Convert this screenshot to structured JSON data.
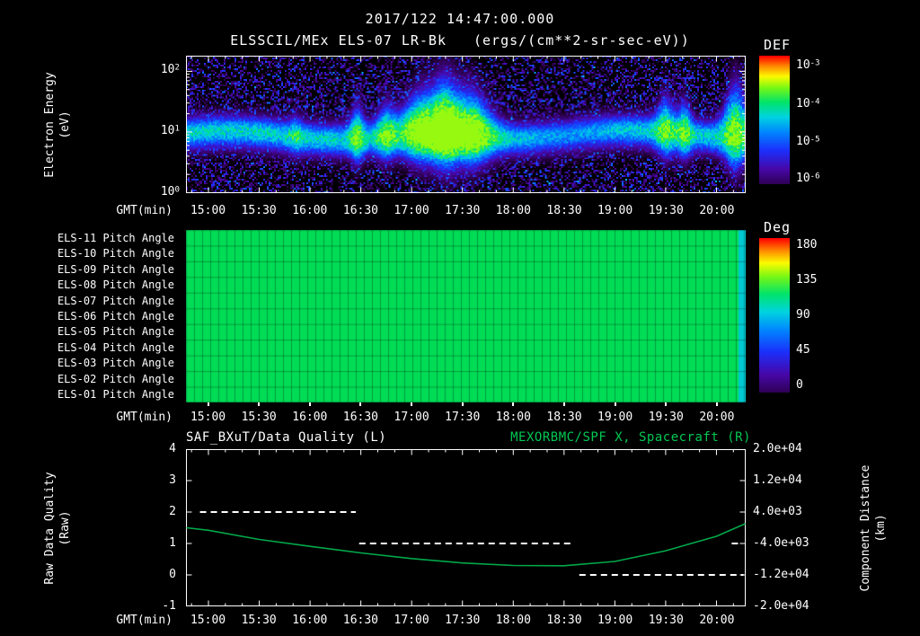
{
  "header": {
    "timestamp": "2017/122 14:47:00.000",
    "instrument_title": "ELSSCIL/MEx ELS-07 LR-Bk",
    "units_label": "(ergs/(cm**2-sr-sec-eV))"
  },
  "time_axis": {
    "label": "GMT(min)",
    "start": "14:47",
    "end": "20:17",
    "ticks": [
      "15:00",
      "15:30",
      "16:00",
      "16:30",
      "17:00",
      "17:30",
      "18:00",
      "18:30",
      "19:00",
      "19:30",
      "20:00"
    ]
  },
  "spectrogram": {
    "ylabel_line1": "Electron Energy",
    "ylabel_line2": "(eV)",
    "y_ticks": [
      {
        "label": "10^2",
        "log": 2
      },
      {
        "label": "10^1",
        "log": 1
      },
      {
        "label": "10^0",
        "log": 0
      }
    ],
    "colorbar": {
      "label": "DEF",
      "ticks": [
        "10^-3",
        "10^-4",
        "10^-5",
        "10^-6"
      ]
    }
  },
  "pitch_panel": {
    "colorbar": {
      "label": "Deg",
      "ticks": [
        "180",
        "135",
        "90",
        "45",
        "0"
      ]
    }
  },
  "bottom_panel": {
    "title_left": "SAF_BXuT/Data Quality (L)",
    "title_right": "MEXORBMC/SPF X, Spacecraft (R)",
    "ylabel_left_line1": "Raw Data Quality",
    "ylabel_left_line2": "(Raw)",
    "ylabel_right_line1": "Component Distance",
    "ylabel_right_line2": "(km)",
    "left_ticks": [
      "4",
      "3",
      "2",
      "1",
      "0",
      "-1"
    ],
    "right_ticks": [
      "2.0e+04",
      "1.2e+04",
      "4.0e+03",
      "-4.0e+03",
      "-1.2e+04",
      "-2.0e+04"
    ]
  },
  "colors": {
    "background": "#000000",
    "text": "#ffffff",
    "accent_green": "#00c853",
    "pitch_fill_green": "#00dc55",
    "pitch_edge_cyan": "#00c9cf"
  },
  "chart_data": [
    {
      "id": "electron-energy-spectrogram",
      "type": "heatmap",
      "title": "ELSSCIL/MEx ELS-07 LR-Bk",
      "units": "ergs/(cm**2-sr-sec-eV)",
      "x_range": [
        "14:47",
        "20:17"
      ],
      "x_ticks": [
        "15:00",
        "15:30",
        "16:00",
        "16:30",
        "17:00",
        "17:30",
        "18:00",
        "18:30",
        "19:00",
        "19:30",
        "20:00"
      ],
      "y_axis": {
        "label": "Electron Energy (eV)",
        "scale": "log",
        "range_eV": [
          1,
          178
        ]
      },
      "z_axis": {
        "label": "DEF",
        "scale": "log",
        "range": [
          1e-06,
          0.001
        ]
      },
      "background": "sparse blue-purple noise speckle over black",
      "band": {
        "center_eV": 9,
        "sigma_decades": 0.18,
        "base_level": 0.6
      },
      "enhancements": [
        {
          "time": "15:52",
          "width_min": 3,
          "amp": 0.1,
          "height": 0.08
        },
        {
          "time": "16:28",
          "width_min": 3,
          "amp": 0.22,
          "height": 0.3
        },
        {
          "time": "16:45",
          "width_min": 4,
          "amp": 0.2,
          "height": 0.25
        },
        {
          "time": "17:05",
          "width_min": 8,
          "amp": 0.26,
          "height": 0.4
        },
        {
          "time": "17:20",
          "width_min": 6,
          "amp": 0.28,
          "height": 0.45
        },
        {
          "time": "17:36",
          "width_min": 8,
          "amp": 0.26,
          "height": 0.4
        },
        {
          "time": "17:25",
          "width_min": 20,
          "amp": 0.12,
          "height": 0.15
        },
        {
          "time": "18:30",
          "width_min": 25,
          "amp": -0.1,
          "height": -0.05
        },
        {
          "time": "19:30",
          "width_min": 4,
          "amp": 0.22,
          "height": 0.35
        },
        {
          "time": "19:41",
          "width_min": 3,
          "amp": 0.2,
          "height": 0.3
        },
        {
          "time": "20:11",
          "width_min": 5,
          "amp": 0.24,
          "height": 0.7
        }
      ]
    },
    {
      "id": "pitch-angle-panel",
      "type": "heatmap",
      "rows": [
        "ELS-11 Pitch Angle",
        "ELS-10 Pitch Angle",
        "ELS-09 Pitch Angle",
        "ELS-08 Pitch Angle",
        "ELS-07 Pitch Angle",
        "ELS-06 Pitch Angle",
        "ELS-05 Pitch Angle",
        "ELS-04 Pitch Angle",
        "ELS-03 Pitch Angle",
        "ELS-02 Pitch Angle",
        "ELS-01 Pitch Angle"
      ],
      "uniform_value_deg": 95,
      "right_edge_value_deg": 50,
      "colorbar": {
        "label": "Deg",
        "range": [
          0,
          180
        ],
        "ticks": [
          180,
          135,
          90,
          45,
          0
        ]
      }
    },
    {
      "id": "quality-and-spacecraft-distance",
      "type": "line",
      "x_ticks": [
        "15:00",
        "15:30",
        "16:00",
        "16:30",
        "17:00",
        "17:30",
        "18:00",
        "18:30",
        "19:00",
        "19:30",
        "20:00"
      ],
      "left_axis": {
        "label": "Raw Data Quality (Raw)",
        "range": [
          -1,
          4
        ],
        "ticks": [
          4,
          3,
          2,
          1,
          0,
          -1
        ]
      },
      "right_axis": {
        "label": "Component Distance (km)",
        "range": [
          -20000,
          20000
        ],
        "ticks": [
          20000,
          12000,
          4000,
          -4000,
          -12000,
          -20000
        ]
      },
      "series": [
        {
          "name": "SAF_BXuT/Data Quality (L)",
          "axis": "left",
          "color": "#ffffff",
          "style": "dashed",
          "segments": [
            {
              "start": "14:55",
              "end": "16:27",
              "value": 2
            },
            {
              "start": "16:29",
              "end": "18:34",
              "value": 1
            },
            {
              "start": "18:39",
              "end": "20:16",
              "value": 0
            },
            {
              "start": "20:09",
              "end": "20:15",
              "value": 1
            }
          ]
        },
        {
          "name": "MEXORBMC/SPF X, Spacecraft (R)",
          "axis": "right",
          "color": "#00a94a",
          "style": "solid",
          "x_time": [
            "14:47",
            "15:00",
            "15:30",
            "16:00",
            "16:30",
            "17:00",
            "17:30",
            "18:00",
            "18:30",
            "19:00",
            "19:30",
            "20:00",
            "20:17"
          ],
          "y_left_units": [
            1.5,
            1.42,
            1.13,
            0.91,
            0.7,
            0.52,
            0.38,
            0.3,
            0.29,
            0.43,
            0.77,
            1.23,
            1.63
          ],
          "y_km": [
            0,
            -640,
            -2960,
            -4720,
            -6400,
            -7840,
            -8960,
            -9600,
            -9680,
            -8560,
            -5840,
            -2160,
            1040
          ]
        }
      ]
    }
  ]
}
